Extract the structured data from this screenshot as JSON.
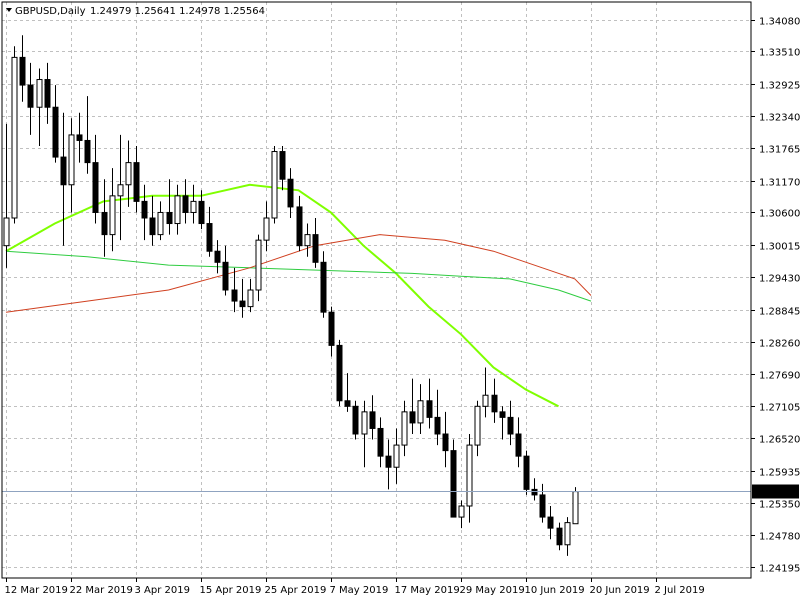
{
  "colors": {
    "background": "#ffffff",
    "frame": "#000000",
    "grid": "#c0c0c0",
    "candle_up_body": "#ffffff",
    "candle_down_body": "#000000",
    "candle_outline": "#000000",
    "current_line": "#8fa3c0",
    "current_label_bg": "#000000",
    "current_label_text": "#ffffff"
  },
  "chart_data": {
    "type": "candlestick",
    "symbol_label": "GBPUSD,Daily",
    "ohlc_label": "1.24979 1.25641 1.24978 1.25564",
    "timeframe_icon": "triangle-down-icon",
    "ylim": [
      1.24,
      1.344
    ],
    "y_ticks": [
      "1.34080",
      "1.33510",
      "1.32925",
      "1.32340",
      "1.31765",
      "1.31170",
      "1.30600",
      "1.30015",
      "1.29430",
      "1.28845",
      "1.28260",
      "1.27690",
      "1.27105",
      "1.26520",
      "1.25935",
      "1.25350",
      "1.24780",
      "1.24195"
    ],
    "current_price": "1.25564",
    "x_ticks": [
      {
        "bar": 0,
        "label": "12 Mar 2019"
      },
      {
        "bar": 8,
        "label": "22 Mar 2019"
      },
      {
        "bar": 16,
        "label": "3 Apr 2019"
      },
      {
        "bar": 24,
        "label": "15 Apr 2019"
      },
      {
        "bar": 32,
        "label": "25 Apr 2019"
      },
      {
        "bar": 40,
        "label": "7 May 2019"
      },
      {
        "bar": 48,
        "label": "17 May 2019"
      },
      {
        "bar": 56,
        "label": "29 May 2019"
      },
      {
        "bar": 64,
        "label": "10 Jun 2019"
      },
      {
        "bar": 72,
        "label": "20 Jun 2019"
      },
      {
        "bar": 80,
        "label": "2 Jul 2019"
      }
    ],
    "candles": [
      [
        1.3,
        1.322,
        1.296,
        1.305
      ],
      [
        1.305,
        1.336,
        1.304,
        1.334
      ],
      [
        1.334,
        1.338,
        1.326,
        1.329
      ],
      [
        1.329,
        1.333,
        1.32,
        1.325
      ],
      [
        1.325,
        1.332,
        1.318,
        1.33
      ],
      [
        1.33,
        1.333,
        1.322,
        1.325
      ],
      [
        1.325,
        1.329,
        1.315,
        1.316
      ],
      [
        1.316,
        1.324,
        1.3,
        1.311
      ],
      [
        1.311,
        1.323,
        1.306,
        1.32
      ],
      [
        1.32,
        1.324,
        1.315,
        1.319
      ],
      [
        1.319,
        1.327,
        1.313,
        1.315
      ],
      [
        1.315,
        1.32,
        1.304,
        1.306
      ],
      [
        1.306,
        1.312,
        1.298,
        1.302
      ],
      [
        1.302,
        1.314,
        1.299,
        1.309
      ],
      [
        1.309,
        1.32,
        1.301,
        1.311
      ],
      [
        1.311,
        1.319,
        1.307,
        1.315
      ],
      [
        1.315,
        1.318,
        1.306,
        1.308
      ],
      [
        1.308,
        1.311,
        1.301,
        1.305
      ],
      [
        1.305,
        1.309,
        1.3,
        1.302
      ],
      [
        1.302,
        1.308,
        1.301,
        1.306
      ],
      [
        1.306,
        1.312,
        1.302,
        1.304
      ],
      [
        1.304,
        1.311,
        1.302,
        1.309
      ],
      [
        1.309,
        1.312,
        1.304,
        1.306
      ],
      [
        1.306,
        1.311,
        1.304,
        1.308
      ],
      [
        1.308,
        1.31,
        1.303,
        1.304
      ],
      [
        1.304,
        1.307,
        1.298,
        1.299
      ],
      [
        1.299,
        1.301,
        1.295,
        1.297
      ],
      [
        1.297,
        1.3,
        1.291,
        1.292
      ],
      [
        1.292,
        1.296,
        1.288,
        1.29
      ],
      [
        1.29,
        1.294,
        1.287,
        1.289
      ],
      [
        1.289,
        1.294,
        1.288,
        1.292
      ],
      [
        1.292,
        1.302,
        1.29,
        1.301
      ],
      [
        1.301,
        1.308,
        1.299,
        1.305
      ],
      [
        1.305,
        1.318,
        1.304,
        1.317
      ],
      [
        1.317,
        1.318,
        1.31,
        1.312
      ],
      [
        1.312,
        1.314,
        1.305,
        1.307
      ],
      [
        1.307,
        1.309,
        1.299,
        1.3
      ],
      [
        1.3,
        1.304,
        1.298,
        1.302
      ],
      [
        1.302,
        1.305,
        1.296,
        1.297
      ],
      [
        1.297,
        1.299,
        1.287,
        1.288
      ],
      [
        1.288,
        1.289,
        1.28,
        1.282
      ],
      [
        1.282,
        1.283,
        1.271,
        1.272
      ],
      [
        1.272,
        1.277,
        1.27,
        1.271
      ],
      [
        1.271,
        1.272,
        1.265,
        1.266
      ],
      [
        1.266,
        1.272,
        1.26,
        1.27
      ],
      [
        1.27,
        1.273,
        1.265,
        1.267
      ],
      [
        1.267,
        1.269,
        1.26,
        1.262
      ],
      [
        1.262,
        1.265,
        1.256,
        1.26
      ],
      [
        1.26,
        1.267,
        1.257,
        1.264
      ],
      [
        1.264,
        1.272,
        1.262,
        1.27
      ],
      [
        1.27,
        1.276,
        1.266,
        1.268
      ],
      [
        1.268,
        1.275,
        1.266,
        1.272
      ],
      [
        1.272,
        1.276,
        1.267,
        1.269
      ],
      [
        1.269,
        1.274,
        1.264,
        1.266
      ],
      [
        1.266,
        1.27,
        1.26,
        1.263
      ],
      [
        1.263,
        1.265,
        1.254,
        1.251
      ],
      [
        1.251,
        1.254,
        1.249,
        1.253
      ],
      [
        1.253,
        1.266,
        1.25,
        1.264
      ],
      [
        1.264,
        1.272,
        1.262,
        1.271
      ],
      [
        1.271,
        1.278,
        1.269,
        1.273
      ],
      [
        1.273,
        1.276,
        1.268,
        1.27
      ],
      [
        1.27,
        1.271,
        1.265,
        1.269
      ],
      [
        1.269,
        1.272,
        1.264,
        1.266
      ],
      [
        1.266,
        1.269,
        1.26,
        1.262
      ],
      [
        1.262,
        1.263,
        1.255,
        1.256
      ],
      [
        1.256,
        1.258,
        1.254,
        1.255
      ],
      [
        1.255,
        1.257,
        1.25,
        1.251
      ],
      [
        1.251,
        1.253,
        1.247,
        1.249
      ],
      [
        1.249,
        1.25,
        1.245,
        1.246
      ],
      [
        1.246,
        1.251,
        1.244,
        1.25
      ],
      [
        1.2498,
        1.2564,
        1.2498,
        1.2556
      ]
    ],
    "ma_lines": [
      {
        "color": "#7fff00",
        "width": 2,
        "points": [
          [
            0,
            1.299
          ],
          [
            6,
            1.304
          ],
          [
            12,
            1.308
          ],
          [
            18,
            1.309
          ],
          [
            24,
            1.309
          ],
          [
            30,
            1.311
          ],
          [
            36,
            1.31
          ],
          [
            40,
            1.306
          ],
          [
            44,
            1.3
          ],
          [
            48,
            1.295
          ],
          [
            52,
            1.289
          ],
          [
            56,
            1.284
          ],
          [
            60,
            1.278
          ],
          [
            64,
            1.274
          ],
          [
            68,
            1.271
          ]
        ]
      },
      {
        "color": "#2ecc40",
        "width": 1,
        "points": [
          [
            0,
            1.299
          ],
          [
            10,
            1.298
          ],
          [
            20,
            1.2965
          ],
          [
            30,
            1.296
          ],
          [
            40,
            1.2955
          ],
          [
            50,
            1.295
          ],
          [
            56,
            1.2945
          ],
          [
            62,
            1.294
          ],
          [
            68,
            1.292
          ],
          [
            72,
            1.29
          ]
        ]
      },
      {
        "color": "#d04020",
        "width": 1,
        "points": [
          [
            0,
            1.288
          ],
          [
            10,
            1.29
          ],
          [
            20,
            1.292
          ],
          [
            30,
            1.296
          ],
          [
            38,
            1.3
          ],
          [
            46,
            1.302
          ],
          [
            54,
            1.301
          ],
          [
            60,
            1.299
          ],
          [
            66,
            1.296
          ],
          [
            70,
            1.294
          ],
          [
            72,
            1.291
          ]
        ]
      }
    ]
  }
}
